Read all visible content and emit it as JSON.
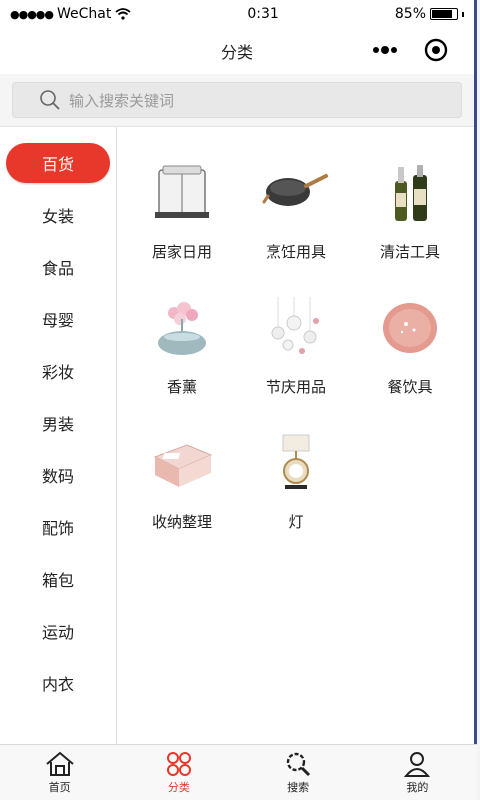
{
  "status": {
    "carrier": "WeChat",
    "time": "0:31",
    "battery": "85%",
    "battery_level": 0.85
  },
  "navbar": {
    "title": "分类"
  },
  "search": {
    "placeholder": "输入搜索关键词"
  },
  "sidebar": {
    "items": [
      {
        "label": "百货",
        "active": true
      },
      {
        "label": "女装"
      },
      {
        "label": "食品"
      },
      {
        "label": "母婴"
      },
      {
        "label": "彩妆"
      },
      {
        "label": "男装"
      },
      {
        "label": "数码"
      },
      {
        "label": "配饰"
      },
      {
        "label": "箱包"
      },
      {
        "label": "运动"
      },
      {
        "label": "内衣"
      }
    ]
  },
  "categories": [
    {
      "label": "居家日用",
      "icon": "knife-block-icon"
    },
    {
      "label": "烹饪用具",
      "icon": "wok-icon"
    },
    {
      "label": "清洁工具",
      "icon": "bottles-icon"
    },
    {
      "label": "香薰",
      "icon": "aroma-flower-icon"
    },
    {
      "label": "节庆用品",
      "icon": "bubbles-icon"
    },
    {
      "label": "餐饮具",
      "icon": "plate-icon"
    },
    {
      "label": "收纳整理",
      "icon": "storage-box-icon"
    },
    {
      "label": "灯",
      "icon": "lamp-icon"
    }
  ],
  "tabbar": {
    "items": [
      {
        "label": "首页",
        "icon": "home-icon"
      },
      {
        "label": "分类",
        "icon": "category-icon",
        "active": true
      },
      {
        "label": "搜索",
        "icon": "search-icon"
      },
      {
        "label": "我的",
        "icon": "user-icon"
      }
    ]
  },
  "colors": {
    "accent": "#e8382b"
  }
}
